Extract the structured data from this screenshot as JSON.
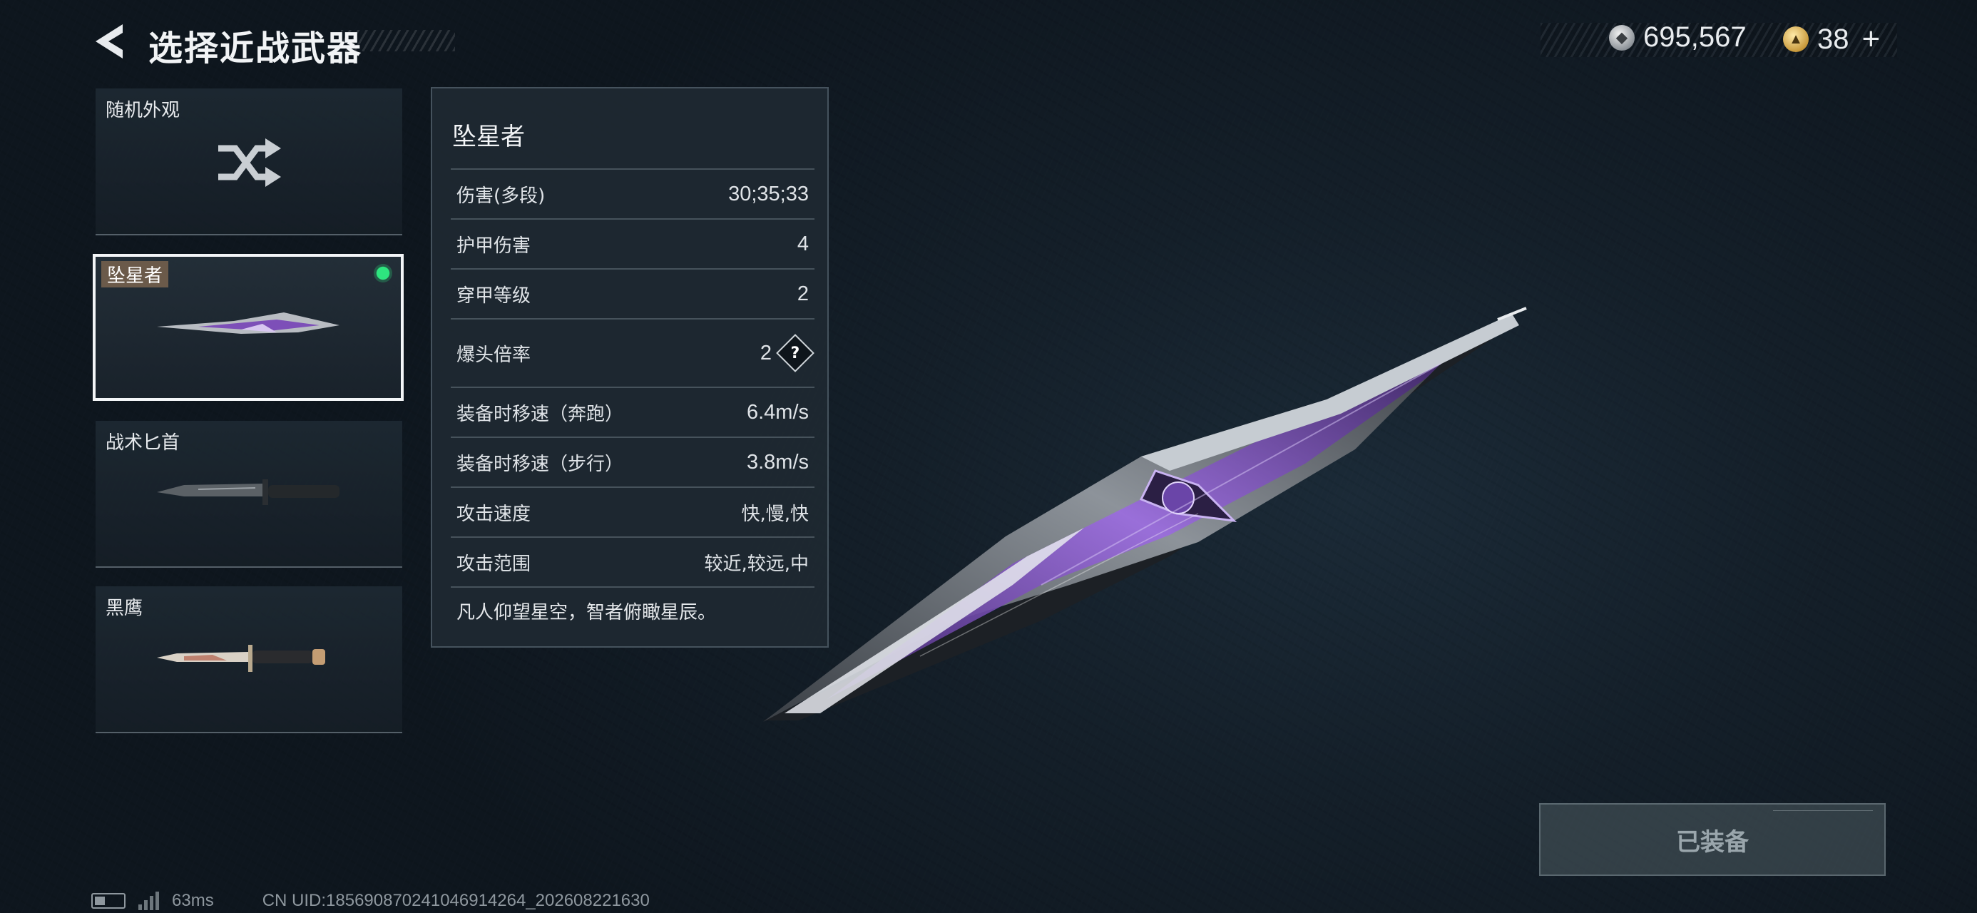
{
  "header": {
    "title": "选择近战武器"
  },
  "currency": {
    "silver_amount": "695,567",
    "gold_amount": "38",
    "plus_symbol": "+"
  },
  "weapons": [
    {
      "name": "随机外观",
      "type": "random"
    },
    {
      "name": "坠星者",
      "type": "knife",
      "selected": true,
      "equipped": true
    },
    {
      "name": "战术匕首",
      "type": "knife"
    },
    {
      "name": "黑鹰",
      "type": "knife"
    }
  ],
  "stats": {
    "title": "坠星者",
    "rows": [
      {
        "label": "伤害(多段)",
        "value": "30;35;33"
      },
      {
        "label": "护甲伤害",
        "value": "4"
      },
      {
        "label": "穿甲等级",
        "value": "2"
      },
      {
        "label": "爆头倍率",
        "value": "2",
        "help": true
      },
      {
        "label": "装备时移速（奔跑）",
        "value": "6.4m/s"
      },
      {
        "label": "装备时移速（步行）",
        "value": "3.8m/s"
      },
      {
        "label": "攻击速度",
        "value": "快,慢,快"
      },
      {
        "label": "攻击范围",
        "value": "较近,较远,中"
      }
    ],
    "flavor": "凡人仰望星空，智者俯瞰星辰。",
    "help_symbol": "?"
  },
  "equip_button": {
    "label": "已装备"
  },
  "status_bar": {
    "ping": "63ms",
    "uid": "CN UID:1856908702410469142​64_202608221630"
  },
  "colors": {
    "equipped_indicator": "#2ee57f",
    "selected_border": "#f3f5f7",
    "knife_accent": "#8a4fd0"
  }
}
